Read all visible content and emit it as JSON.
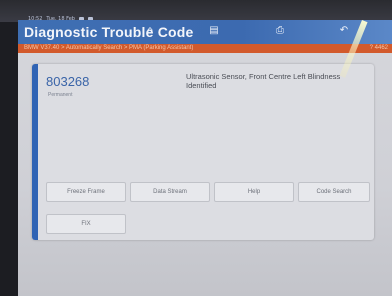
{
  "status_bar": {
    "time": "10:52",
    "date": "Tue, 18 Feb"
  },
  "header": {
    "title": "Diagnostic Trouble Code"
  },
  "breadcrumb": {
    "path": "BMW V37.40 > Automatically Search > PMA (Parking Assistant)",
    "right": "? 4462"
  },
  "dtc": {
    "code": "803268",
    "status": "Permanent",
    "description": "Ultrasonic Sensor, Front Centre Left Blindness Identified"
  },
  "buttons": {
    "freeze_frame": "Freeze Frame",
    "data_stream": "Data Stream",
    "help": "Help",
    "code_search": "Code Search",
    "fix": "FIX"
  },
  "colors": {
    "header": "#3f6fb3",
    "breadcrumb": "#d25a2c",
    "accent": "#2f63b4"
  }
}
